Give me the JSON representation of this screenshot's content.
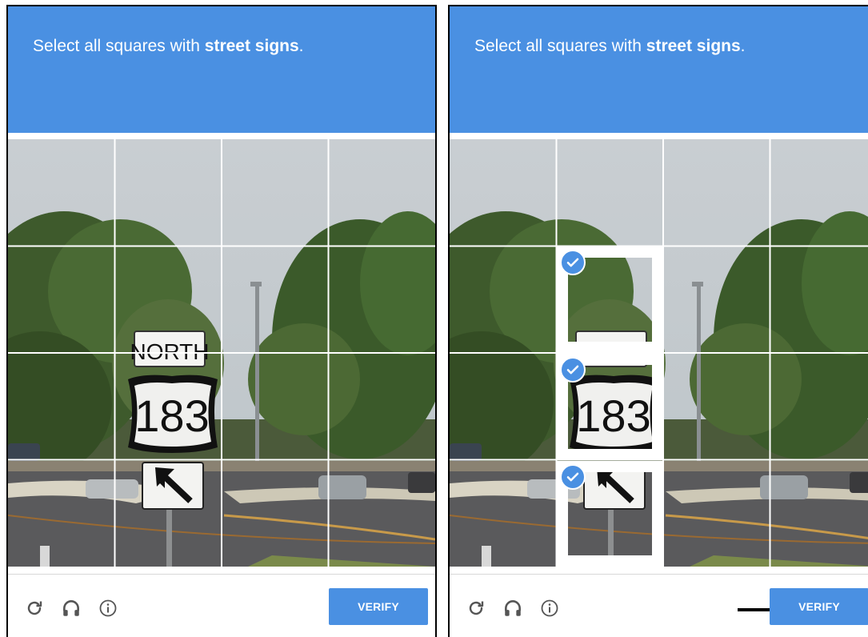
{
  "captcha": {
    "prompt_prefix": "Select all squares with ",
    "prompt_target": "street signs",
    "prompt_suffix": ".",
    "verify_label": "VERIFY",
    "sign_top_text": "NORTH",
    "sign_route_number": "183",
    "sign_top_text_cropped": "NORTH",
    "icons": [
      "reload-icon",
      "audio-headphones-icon",
      "info-icon"
    ],
    "accent_color": "#4a90e2",
    "left_panel": {
      "selected_tiles": []
    },
    "right_panel": {
      "selected_tiles": [
        "r2c2",
        "r3c2",
        "r4c2"
      ]
    }
  }
}
